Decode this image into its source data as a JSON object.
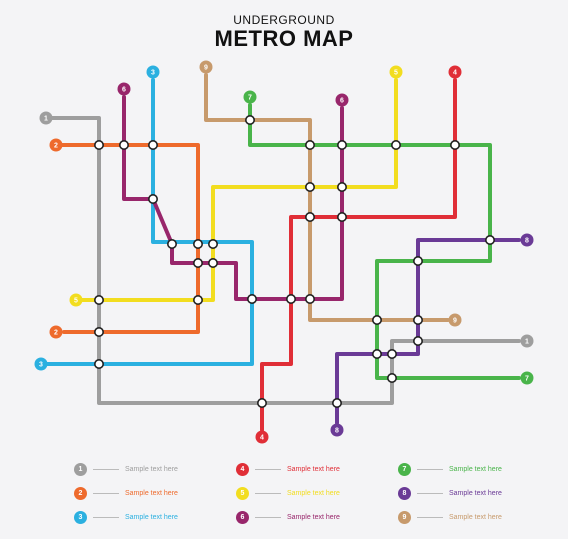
{
  "title": {
    "subtitle": "UNDERGROUND",
    "main": "METRO MAP"
  },
  "colors": {
    "line1": "#9e9e9e",
    "line2": "#ee6a2c",
    "line3": "#2bb0e0",
    "line4": "#e02e37",
    "line5": "#f2dd1f",
    "line6": "#98266b",
    "line7": "#49b44a",
    "line8": "#6a3a96",
    "line9": "#c79a6c",
    "station_fill": "#ffffff",
    "station_stroke": "#222222"
  },
  "lines": [
    {
      "id": "1",
      "label": "1",
      "color": "#9e9e9e"
    },
    {
      "id": "2",
      "label": "2",
      "color": "#ee6a2c"
    },
    {
      "id": "3",
      "label": "3",
      "color": "#2bb0e0"
    },
    {
      "id": "4",
      "label": "4",
      "color": "#e02e37"
    },
    {
      "id": "5",
      "label": "5",
      "color": "#f2dd1f"
    },
    {
      "id": "6",
      "label": "6",
      "color": "#98266b"
    },
    {
      "id": "7",
      "label": "7",
      "color": "#49b44a"
    },
    {
      "id": "8",
      "label": "8",
      "color": "#6a3a96"
    },
    {
      "id": "9",
      "label": "9",
      "color": "#c79a6c"
    }
  ],
  "legend": [
    {
      "label": "1",
      "text": "Sample text here",
      "color": "#9e9e9e"
    },
    {
      "label": "2",
      "text": "Sample text here",
      "color": "#ee6a2c"
    },
    {
      "label": "3",
      "text": "Sample text here",
      "color": "#2bb0e0"
    },
    {
      "label": "4",
      "text": "Sample text here",
      "color": "#e02e37"
    },
    {
      "label": "5",
      "text": "Sample text here",
      "color": "#f2dd1f"
    },
    {
      "label": "6",
      "text": "Sample text here",
      "color": "#98266b"
    },
    {
      "label": "7",
      "text": "Sample text here",
      "color": "#49b44a"
    },
    {
      "label": "8",
      "text": "Sample text here",
      "color": "#6a3a96"
    },
    {
      "label": "9",
      "text": "Sample text here",
      "color": "#c79a6c"
    }
  ]
}
